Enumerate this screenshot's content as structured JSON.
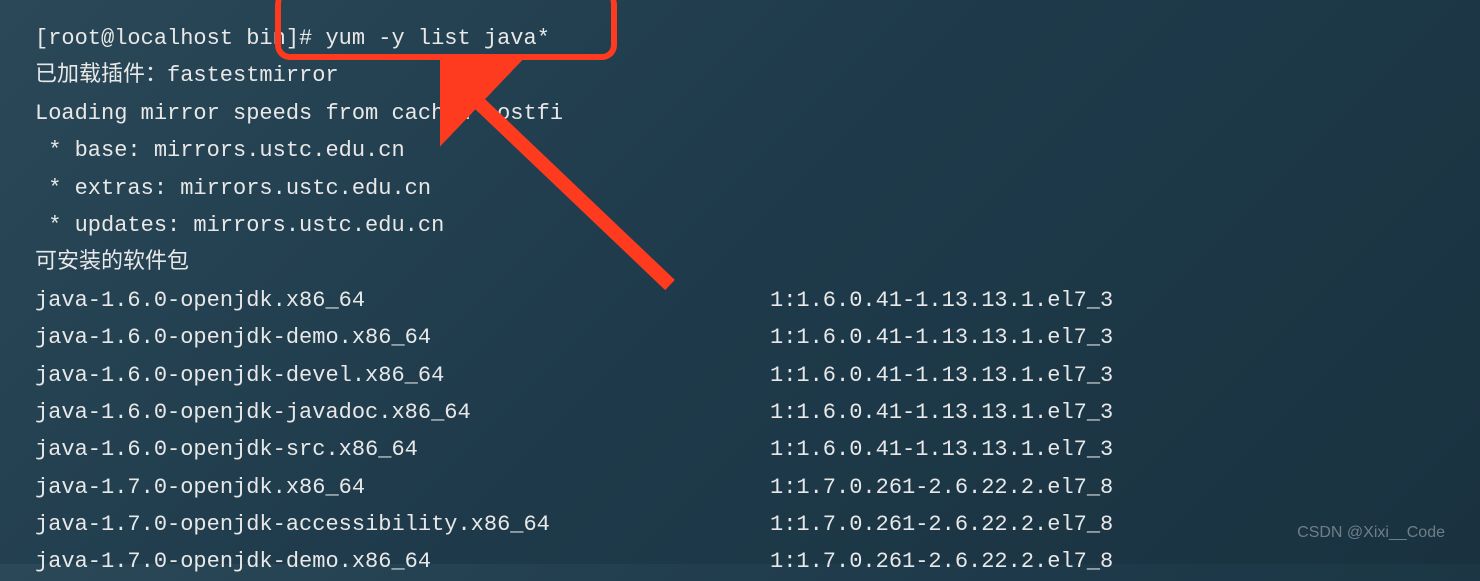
{
  "terminal": {
    "prompt": "[root@localhost bin]# ",
    "command": "yum -y list java*",
    "lines": [
      "已加载插件：fastestmirror",
      "Loading mirror speeds from cached hostfi",
      " * base: mirrors.ustc.edu.cn",
      " * extras: mirrors.ustc.edu.cn",
      " * updates: mirrors.ustc.edu.cn",
      "可安装的软件包"
    ],
    "packages": [
      {
        "name": "java-1.6.0-openjdk.x86_64",
        "version": "1:1.6.0.41-1.13.13.1.el7_3"
      },
      {
        "name": "java-1.6.0-openjdk-demo.x86_64",
        "version": "1:1.6.0.41-1.13.13.1.el7_3"
      },
      {
        "name": "java-1.6.0-openjdk-devel.x86_64",
        "version": "1:1.6.0.41-1.13.13.1.el7_3"
      },
      {
        "name": "java-1.6.0-openjdk-javadoc.x86_64",
        "version": "1:1.6.0.41-1.13.13.1.el7_3"
      },
      {
        "name": "java-1.6.0-openjdk-src.x86_64",
        "version": "1:1.6.0.41-1.13.13.1.el7_3"
      },
      {
        "name": "java-1.7.0-openjdk.x86_64",
        "version": "1:1.7.0.261-2.6.22.2.el7_8"
      },
      {
        "name": "java-1.7.0-openjdk-accessibility.x86_64",
        "version": "1:1.7.0.261-2.6.22.2.el7_8"
      },
      {
        "name": "java-1.7.0-openjdk-demo.x86_64",
        "version": "1:1.7.0.261-2.6.22.2.el7_8"
      }
    ]
  },
  "watermark": "CSDN @Xixi__Code"
}
